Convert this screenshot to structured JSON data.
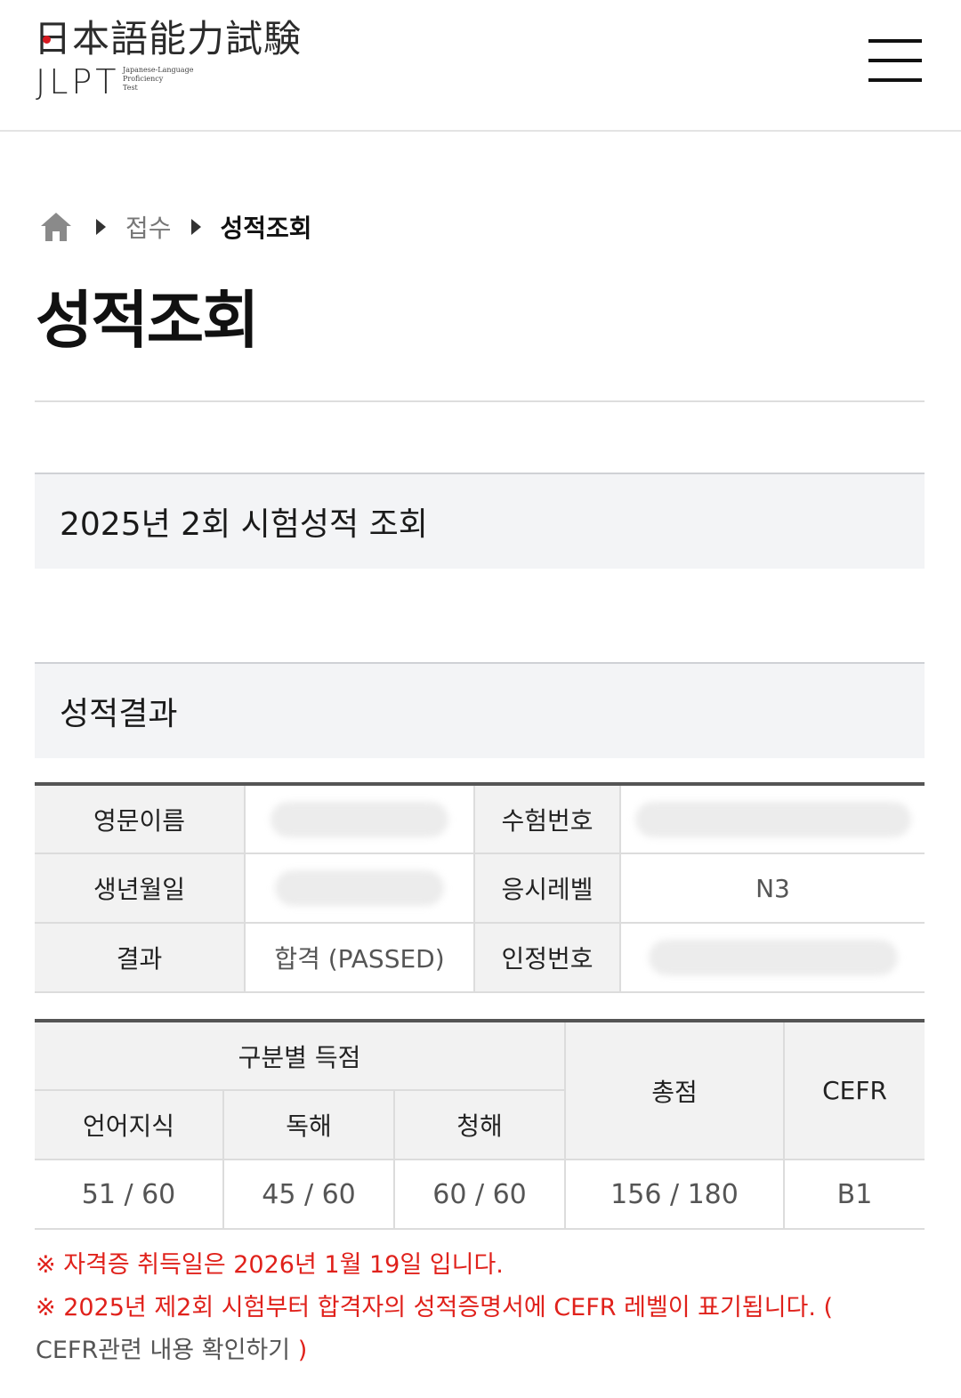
{
  "header": {
    "logo_kanji": "日本語能力試験",
    "logo_abbr": "JLPT",
    "logo_subtitle": "Japanese-Language\nProficiency\nTest",
    "menu_icon": "hamburger-menu-icon"
  },
  "breadcrumb": {
    "home_icon": "home-icon",
    "items": [
      "접수",
      "성적조회"
    ]
  },
  "page_title": "성적조회",
  "exam_box_title": "2025년 2회 시험성적 조회",
  "result_box_title": "성적결과",
  "info": {
    "english_name_label": "영문이름",
    "english_name_value": "",
    "exam_number_label": "수험번호",
    "exam_number_value": "",
    "birthdate_label": "생년월일",
    "birthdate_value": "",
    "level_label": "응시레벨",
    "level_value": "N3",
    "result_label": "결과",
    "result_value": "합격 (PASSED)",
    "cert_number_label": "인정번호",
    "cert_number_value": ""
  },
  "scores": {
    "section_header": "구분별 득점",
    "total_header": "총점",
    "cefr_header": "CEFR",
    "columns": [
      "언어지식",
      "독해",
      "청해"
    ],
    "values": [
      "51 / 60",
      "45 / 60",
      "60 / 60"
    ],
    "total": "156 / 180",
    "cefr": "B1"
  },
  "notes": {
    "line1": "※ 자격증 취득일은 2026년 1월 19일 입니다.",
    "line2": "※ 2025년 제2회 시험부터 합격자의 성적증명서에 CEFR 레벨이 표기됩니다. (",
    "link_text": "CEFR관련 내용 확인하기",
    "link_close": ")"
  },
  "colors": {
    "accent_red": "#e0211b",
    "box_bg": "#f3f4f6",
    "header_cell_bg": "#f2f2f2"
  }
}
